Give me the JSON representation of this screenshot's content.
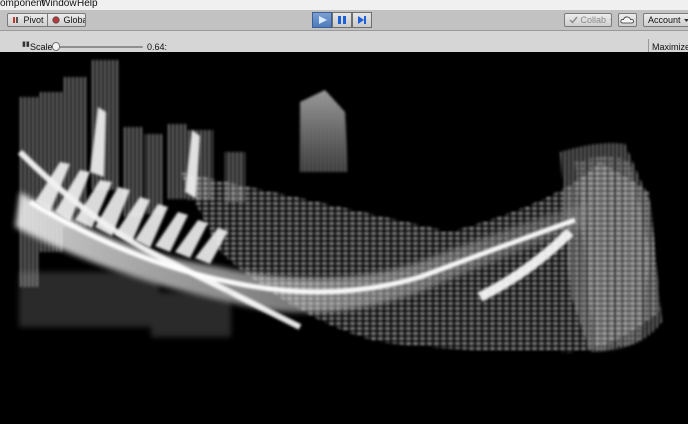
{
  "menu": {
    "items": [
      "omponent",
      "Window",
      "Help"
    ]
  },
  "toolbar": {
    "pivot_label": "Pivot",
    "global_label": "Global",
    "collab_label": "Collab",
    "account_label": "Account",
    "play_state": "playing"
  },
  "gameview": {
    "scale_label": "Scale",
    "scale_value_text": "0.64:",
    "scale_fraction": 0.02,
    "maximize_label": "Maximize C"
  },
  "icons": {
    "pivot": "pivot-icon",
    "global": "global-icon",
    "play": "play-icon",
    "pause": "pause-icon",
    "step": "step-icon",
    "collab": "collab-icon",
    "cloud": "cloud-icon",
    "dropdown": "dropdown-arrow-icon"
  },
  "colors": {
    "accent": "#4f7bbd",
    "play_icon": "#1d5fd6"
  }
}
